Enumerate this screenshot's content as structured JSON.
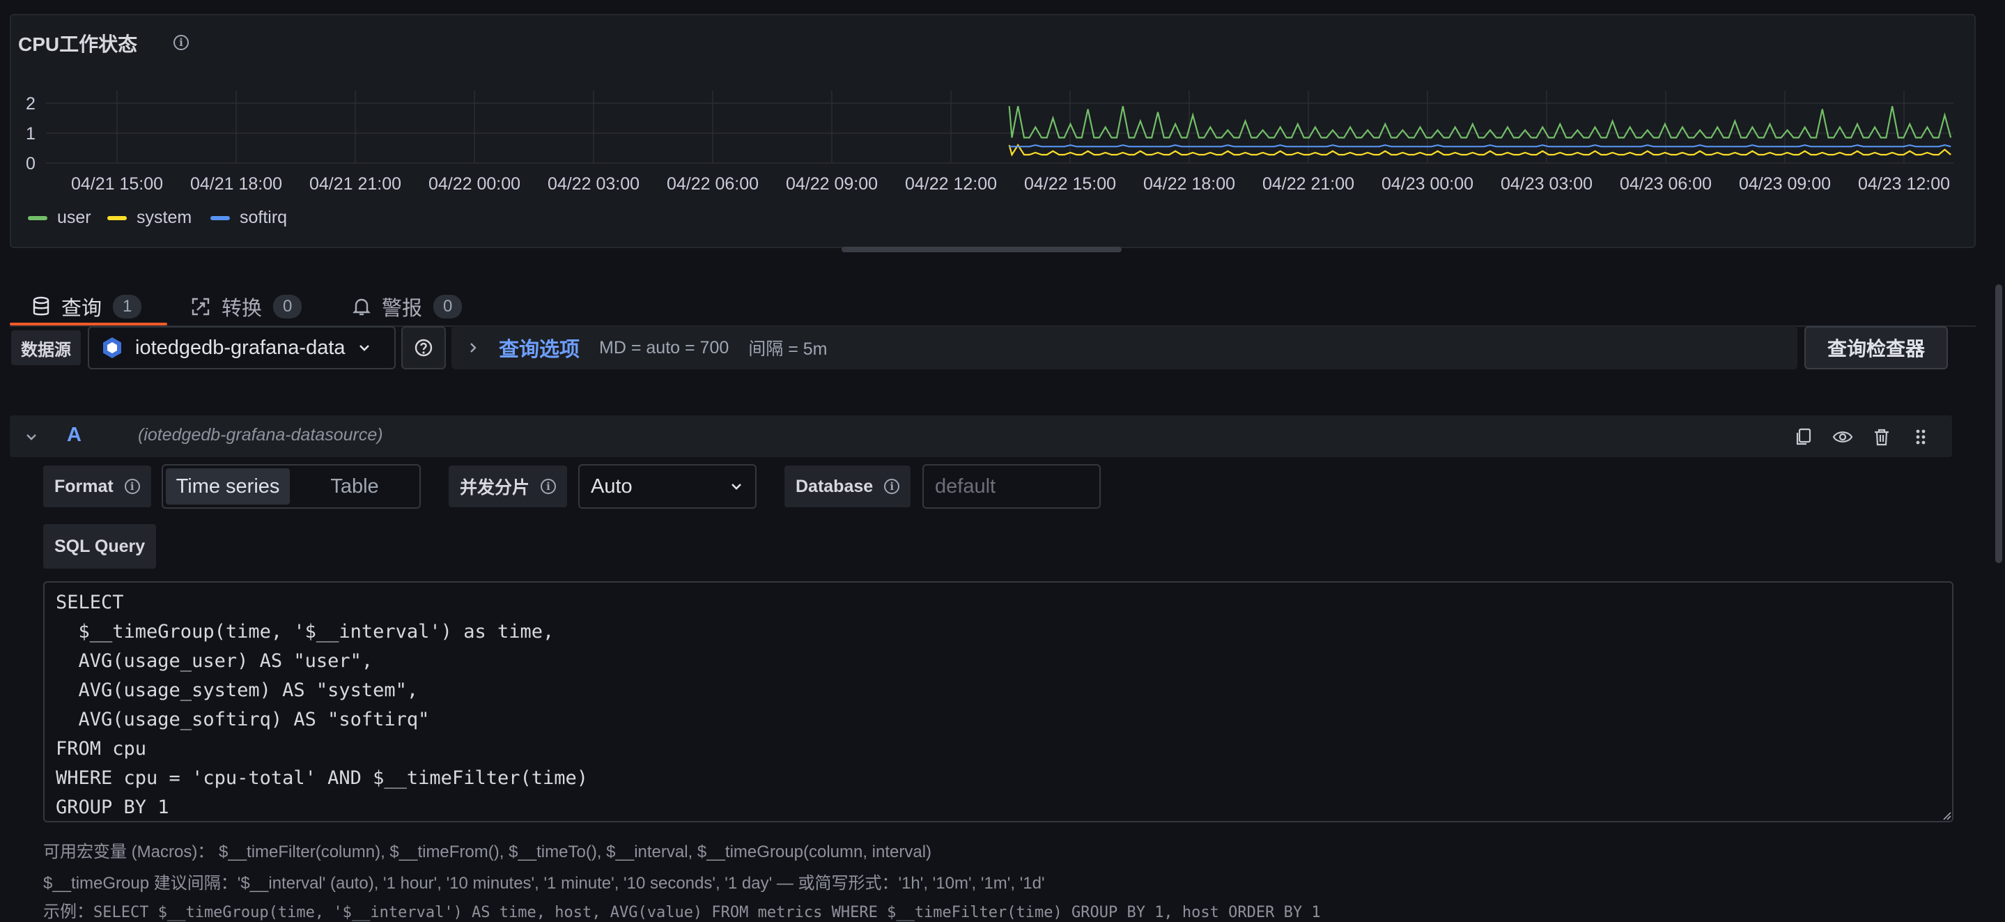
{
  "panel": {
    "title": "CPU工作状态",
    "info_icon": "info-circle-icon"
  },
  "chart_data": {
    "type": "line",
    "title": "CPU工作状态",
    "y_ticks": [
      "2",
      "1",
      "0"
    ],
    "ylim": [
      0,
      2
    ],
    "x_ticks": [
      "04/21 15:00",
      "04/21 18:00",
      "04/21 21:00",
      "04/22 00:00",
      "04/22 03:00",
      "04/22 06:00",
      "04/22 09:00",
      "04/22 12:00",
      "04/22 15:00",
      "04/22 18:00",
      "04/22 21:00",
      "04/23 00:00",
      "04/23 03:00",
      "04/23 06:00",
      "04/23 09:00",
      "04/23 12:00"
    ],
    "grid": true,
    "legend_position": "bottom-left",
    "data_start_fraction": 0.505,
    "series": [
      {
        "name": "user",
        "color": "#73bf69",
        "baseline": 0.85,
        "spikes": [
          1.9,
          1.2,
          1.5,
          1.3,
          1.8,
          1.2,
          1.9,
          1.4,
          1.7,
          1.3,
          1.6,
          1.2,
          1.1,
          1.4,
          1.1,
          1.2,
          1.3,
          1.2,
          1.1,
          1.2,
          1.1,
          1.3,
          1.1,
          1.2,
          1.1,
          1.2,
          1.3,
          1.1,
          1.2,
          1.1,
          1.2,
          1.3,
          1.1,
          1.2,
          1.4,
          1.2,
          1.1,
          1.3,
          1.2,
          1.1,
          1.2,
          1.4,
          1.2,
          1.3,
          1.1,
          1.2,
          1.8,
          1.2,
          1.3,
          1.2,
          1.9,
          1.3,
          1.2,
          1.6
        ]
      },
      {
        "name": "system",
        "color": "#fade2a",
        "baseline": 0.28,
        "spikes": [
          0.6,
          0.35,
          0.4,
          0.35,
          0.4,
          0.35,
          0.35,
          0.4,
          0.35,
          0.4,
          0.35,
          0.35,
          0.4,
          0.35,
          0.35,
          0.4,
          0.35,
          0.35,
          0.4,
          0.35,
          0.35,
          0.4,
          0.35,
          0.35,
          0.4,
          0.35,
          0.35,
          0.4,
          0.35,
          0.35,
          0.4,
          0.35,
          0.35,
          0.4,
          0.35,
          0.35,
          0.4,
          0.35,
          0.35,
          0.4,
          0.35,
          0.35,
          0.4,
          0.35,
          0.35,
          0.4,
          0.35,
          0.35,
          0.4,
          0.35,
          0.35,
          0.4,
          0.35,
          0.45
        ]
      },
      {
        "name": "softirq",
        "color": "#5794f2",
        "baseline": 0.55,
        "spikes": [
          0.55,
          0.6,
          0.55,
          0.6,
          0.55,
          0.55,
          0.6,
          0.55,
          0.55,
          0.6,
          0.55,
          0.55,
          0.6,
          0.55,
          0.55,
          0.6,
          0.55,
          0.55,
          0.6,
          0.55,
          0.55,
          0.6,
          0.55,
          0.55,
          0.6,
          0.55,
          0.55,
          0.6,
          0.55,
          0.55,
          0.6,
          0.55,
          0.55,
          0.6,
          0.55,
          0.55,
          0.6,
          0.55,
          0.55,
          0.6,
          0.55,
          0.55,
          0.6,
          0.55,
          0.55,
          0.6,
          0.55,
          0.55,
          0.6,
          0.55,
          0.55,
          0.6,
          0.55,
          0.6
        ]
      }
    ]
  },
  "tabs": [
    {
      "label": "查询",
      "count": "1",
      "icon": "database-icon"
    },
    {
      "label": "转换",
      "count": "0",
      "icon": "transform-icon"
    },
    {
      "label": "警报",
      "count": "0",
      "icon": "bell-icon"
    }
  ],
  "datasource": {
    "label": "数据源",
    "selected": "iotedgedb-grafana-data",
    "help_icon": "question-circle-icon"
  },
  "query_options": {
    "title": "查询选项",
    "md": "MD = auto = 700",
    "interval": "间隔 = 5m",
    "inspector_label": "查询检查器"
  },
  "query": {
    "ref": "A",
    "datasource": "(iotedgedb-grafana-datasource)",
    "format_label": "Format",
    "format_options": [
      "Time series",
      "Table"
    ],
    "format_selected": "Time series",
    "shard_label": "并发分片",
    "shard_value": "Auto",
    "database_label": "Database",
    "database_placeholder": "default",
    "sql_label": "SQL Query",
    "sql_lines": [
      "SELECT",
      "  $__timeGroup(time, '$__interval') as time,",
      "  AVG(usage_user) AS \"user\",",
      "  AVG(usage_system) AS \"system\",",
      "  AVG(usage_softirq) AS \"softirq\"",
      "FROM cpu",
      "WHERE cpu = 'cpu-total' AND $__timeFilter(time)",
      "GROUP BY 1"
    ]
  },
  "help": {
    "macros": "可用宏变量 (Macros)： $__timeFilter(column), $__timeFrom(), $__timeTo(), $__interval, $__timeGroup(column, interval)",
    "timegroup": "$__timeGroup 建议间隔：'$__interval' (auto), '1 hour', '10 minutes', '1 minute', '10 seconds', '1 day' — 或简写形式：'1h', '10m', '1m', '1d'",
    "example_prefix": "示例：",
    "example_code": "SELECT $__timeGroup(time, '$__interval') AS time, host, AVG(value) FROM metrics WHERE $__timeFilter(time) GROUP BY 1, host ORDER BY 1"
  }
}
